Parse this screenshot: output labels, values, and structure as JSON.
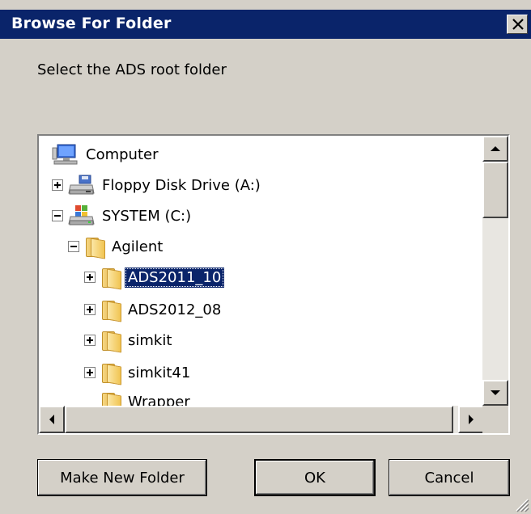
{
  "dialog": {
    "title": "Browse For Folder",
    "prompt": "Select the ADS root folder",
    "close_label": "×",
    "icons": {
      "close": "close-icon",
      "computer": "computer-icon",
      "floppy": "floppy-drive-icon",
      "system_drive": "hard-drive-icon",
      "folder": "folder-icon"
    }
  },
  "tree": {
    "items": [
      {
        "label": "Computer",
        "level": 0,
        "expander": "none",
        "icon": "computer-icon"
      },
      {
        "label": "Floppy Disk Drive (A:)",
        "level": 1,
        "expander": "plus",
        "icon": "floppy-drive-icon"
      },
      {
        "label": "SYSTEM (C:)",
        "level": 1,
        "expander": "minus",
        "icon": "hard-drive-icon"
      },
      {
        "label": "Agilent",
        "level": 2,
        "expander": "minus",
        "icon": "folder-icon"
      },
      {
        "label": "ADS2011_10",
        "level": 3,
        "expander": "plus",
        "icon": "folder-icon",
        "selected": true
      },
      {
        "label": "ADS2012_08",
        "level": 3,
        "expander": "plus",
        "icon": "folder-icon"
      },
      {
        "label": "simkit",
        "level": 3,
        "expander": "plus",
        "icon": "folder-icon"
      },
      {
        "label": "simkit41",
        "level": 3,
        "expander": "plus",
        "icon": "folder-icon"
      },
      {
        "label": "Wrapper",
        "level": 3,
        "expander": "none",
        "icon": "folder-icon"
      }
    ]
  },
  "buttons": {
    "make_new_folder": "Make New Folder",
    "ok": "OK",
    "cancel": "Cancel"
  },
  "colors": {
    "title_bar": "#0a246a",
    "dialog_bg": "#d4d0c8",
    "selection": "#0a246a"
  }
}
